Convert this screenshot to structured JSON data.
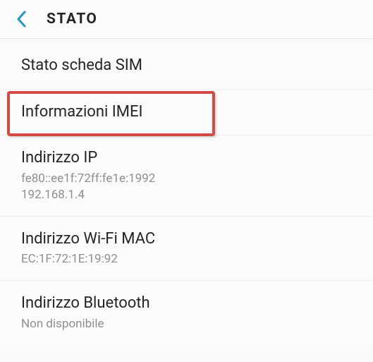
{
  "header": {
    "title": "STATO"
  },
  "items": [
    {
      "title": "Stato scheda SIM",
      "subtitle": null
    },
    {
      "title": "Informazioni IMEI",
      "subtitle": null
    },
    {
      "title": "Indirizzo IP",
      "subtitle": "fe80::ee1f:72ff:fe1e:1992\n192.168.1.4"
    },
    {
      "title": "Indirizzo Wi-Fi MAC",
      "subtitle": "EC:1F:72:1E:19:92"
    },
    {
      "title": "Indirizzo Bluetooth",
      "subtitle": "Non disponibile"
    }
  ]
}
